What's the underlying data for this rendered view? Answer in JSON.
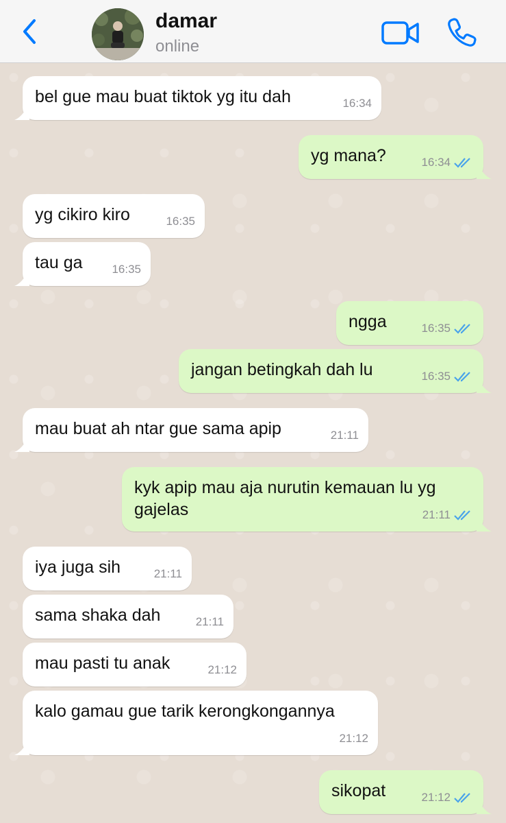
{
  "header": {
    "contact_name": "damar",
    "status": "online",
    "accent_color": "#007aff"
  },
  "messages": [
    {
      "text": "bel gue mau buat tiktok yg itu dah",
      "time": "16:34",
      "direction": "in"
    },
    {
      "text": "yg mana?",
      "time": "16:34",
      "direction": "out",
      "read": true
    },
    {
      "text": "yg cikiro kiro",
      "time": "16:35",
      "direction": "in"
    },
    {
      "text": "tau ga",
      "time": "16:35",
      "direction": "in"
    },
    {
      "text": "ngga",
      "time": "16:35",
      "direction": "out",
      "read": true
    },
    {
      "text": "jangan betingkah dah lu",
      "time": "16:35",
      "direction": "out",
      "read": true
    },
    {
      "text": "mau buat ah ntar gue sama apip",
      "time": "21:11",
      "direction": "in"
    },
    {
      "text": "kyk apip mau aja nurutin kemauan lu yg gajelas",
      "time": "21:11",
      "direction": "out",
      "read": true
    },
    {
      "text": "iya juga sih",
      "time": "21:11",
      "direction": "in"
    },
    {
      "text": "sama shaka dah",
      "time": "21:11",
      "direction": "in"
    },
    {
      "text": "mau pasti tu anak",
      "time": "21:12",
      "direction": "in"
    },
    {
      "text": "kalo gamau gue tarik kerongkongannya",
      "time": "21:12",
      "direction": "in"
    },
    {
      "text": "sikopat",
      "time": "21:12",
      "direction": "out",
      "read": true
    }
  ]
}
